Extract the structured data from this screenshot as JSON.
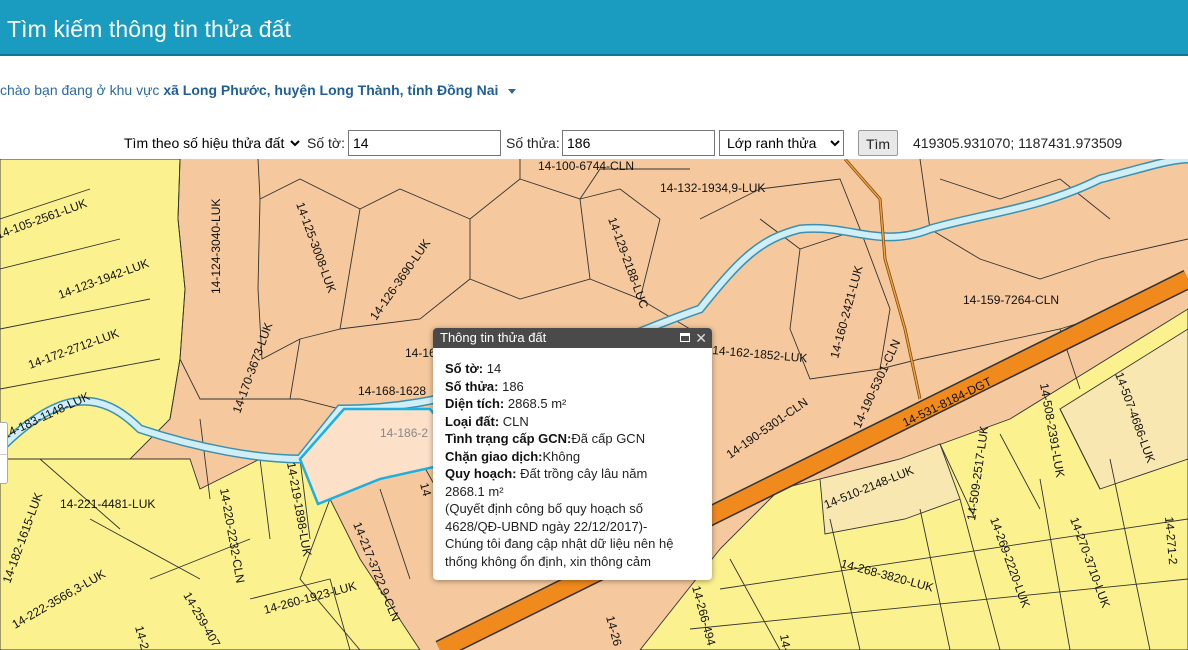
{
  "header": {
    "title": "Tìm kiếm thông tin thửa đất"
  },
  "location": {
    "prefix": "chào bạn đang ở khu vực",
    "area": "xã Long Phước, huyện Long Thành, tỉnh Đồng Nai"
  },
  "search": {
    "mode": "Tìm theo số hiệu thửa đất",
    "to_label": "Số tờ:",
    "to_value": "14",
    "thua_label": "Số thửa:",
    "thua_value": "186",
    "layer": "Lớp ranh thửa",
    "button": "Tìm",
    "coordinates": "419305.931070; 1187431.973509"
  },
  "map": {
    "parcel_labels": [
      "14-100-6744-CLN",
      "14-132-1934,9-LUK",
      "14-105-2561-LUK",
      "14-124-3040-LUK",
      "14-125-3008-LUK",
      "14-126-3690-LUK",
      "14-129-2188-LUC",
      "14-123-1942-LUK",
      "14-159-7264-CLN",
      "14-172-2712-LUK",
      "14-170-3673-LUK",
      "14-16",
      "14-160-2421-LUK",
      "14-162-1852-LUK",
      "14-168-1628",
      "14-190-5301-CLN",
      "14-531-8184-DGT",
      "14-507-4686-LUK",
      "14-183-1148-LUK",
      "14-186-2",
      "14-508-2391-LUK",
      "14-190-5301-CLN",
      "14-509-2517-LUK",
      "14-182-1615-LUK",
      "14-220-2232-CLN",
      "14-219-1898-LUK",
      "14-221-4481-LUK",
      "14-510-2148-LUK",
      "14-217-3722,9-CLN",
      "14-269-2220-LUK",
      "14-270-3710-LUK",
      "14-268-3820-LUK",
      "14-271-2",
      "14-222-3566,3-LUK",
      "14-259-407",
      "14-260-1923-LUK",
      "14-26",
      "14-266-494",
      "14-2",
      "14-",
      "14"
    ],
    "colors": {
      "cln": "#f5c99d",
      "luk": "#fbf18e",
      "luk_light": "#f8e7b0",
      "road": "#f08a1c",
      "river": "#cfeef5",
      "selected": "#fde0c8"
    }
  },
  "popup": {
    "title": "Thông tin thửa đất",
    "so_to_label": "Số tờ:",
    "so_to_value": "14",
    "so_thua_label": "Số thửa:",
    "so_thua_value": "186",
    "dien_tich_label": "Diện tích:",
    "dien_tich_value": "2868.5 m²",
    "loai_dat_label": "Loại đất:",
    "loai_dat_value": "CLN",
    "gcn_label": "Tình trạng cấp GCN:",
    "gcn_value": "Đã cấp GCN",
    "chan_label": "Chặn giao dịch:",
    "chan_value": "Không",
    "quy_hoach_label": "Quy hoạch:",
    "quy_hoach_value": "Đất trồng cây lâu năm",
    "quy_hoach_area": "2868.1 m²",
    "note_1": "(Quyết định công bố quy hoạch số",
    "note_2": "4628/QĐ-UBND ngày 22/12/2017)-",
    "note_3": "Chúng tôi đang cập nhật dữ liệu nên hệ",
    "note_4": "thống không ổn định, xin thông cảm"
  }
}
